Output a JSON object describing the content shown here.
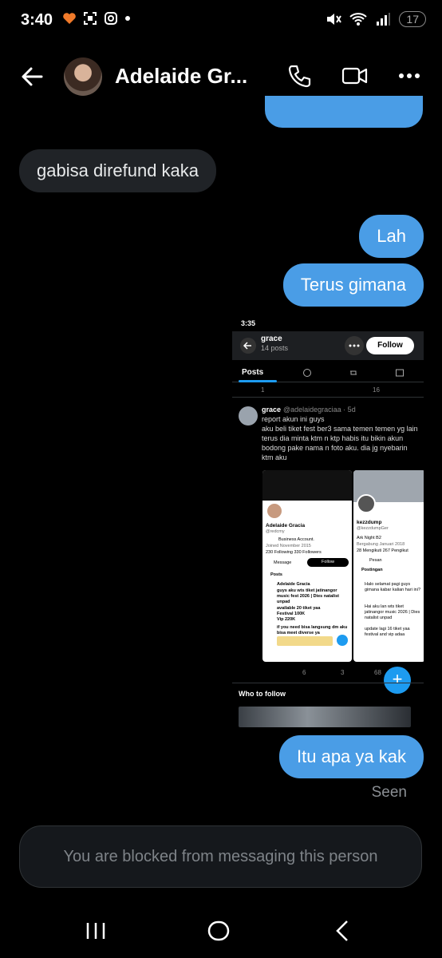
{
  "status_bar": {
    "time": "3:40",
    "battery": "17"
  },
  "header": {
    "contact_name": "Adelaide Gr..."
  },
  "messages": [
    {
      "from": "them",
      "text": "gabisa direfund kaka"
    },
    {
      "from": "me",
      "text": "Lah"
    },
    {
      "from": "me",
      "text": "Terus gimana"
    },
    {
      "from": "me",
      "text": "Itu apa ya kak"
    }
  ],
  "seen_label": "Seen",
  "blocked_text": "You are blocked from messaging this person",
  "shared_screenshot": {
    "status_time": "3:35",
    "profile_name": "grace",
    "post_count": "14 posts",
    "follow_label": "Follow",
    "tab_label": "Posts",
    "stats_top": {
      "replies": "1",
      "views": "16"
    },
    "tweet": {
      "name": "grace",
      "handle": "@adelaidegraciaa · 5d",
      "text": "report akun ini guys\naku beli tiket fest ber3 sama temen temen yg lain terus dia minta ktm n ktp habis itu bikin akun bodong pake nama n foto aku. dia jg nyebarin ktm aku"
    },
    "inner_left": {
      "name": "Adelaide Gracia",
      "handle": "@redcmy",
      "bio": "Business Account.",
      "joined": "Joined November 2015",
      "stats": "230 Following  330 Followers",
      "message_label": "Message",
      "follow_label": "Follow",
      "tab": "Posts",
      "post_name": "Adelaide Gracia",
      "post_text": "guys aku wts tiket jatinangor music fest 2026 | Dies natalist unpad",
      "post_text2": "available 20 tiket yaa\nFestival 100K\nVip 220K",
      "post_text3": "if you need bisa langsung dm aku bisa meet diverse ya"
    },
    "inner_right": {
      "name": "kezzdump",
      "handle": "@kezzdumpGer",
      "bio": "Ark Night B2",
      "joined": "Bergabung Januari 2018",
      "stats": "28 Mengikuti  267 Pengikut",
      "message_label": "Pesan",
      "tab": "Postingan",
      "post_text": "Halo selamat pagi guys gimana kabar kalian hari ini?",
      "post_text2": "Hai aku lan wts tiket jatinangor music 2026 | Dies natalist unpad",
      "post_text3": "update lagi 16 tiket yaa festival and vip adaa"
    },
    "stats_bottom": {
      "retweets": "6",
      "likes": "3",
      "views": "68"
    },
    "who_to_follow": "Who to follow"
  },
  "icons": {
    "back": "arrow-left-icon",
    "call": "phone-icon",
    "video": "video-camera-icon",
    "more": "more-horizontal-icon"
  },
  "colors": {
    "accent": "#4a9de6",
    "background": "#000000",
    "them_bubble": "#202327"
  }
}
